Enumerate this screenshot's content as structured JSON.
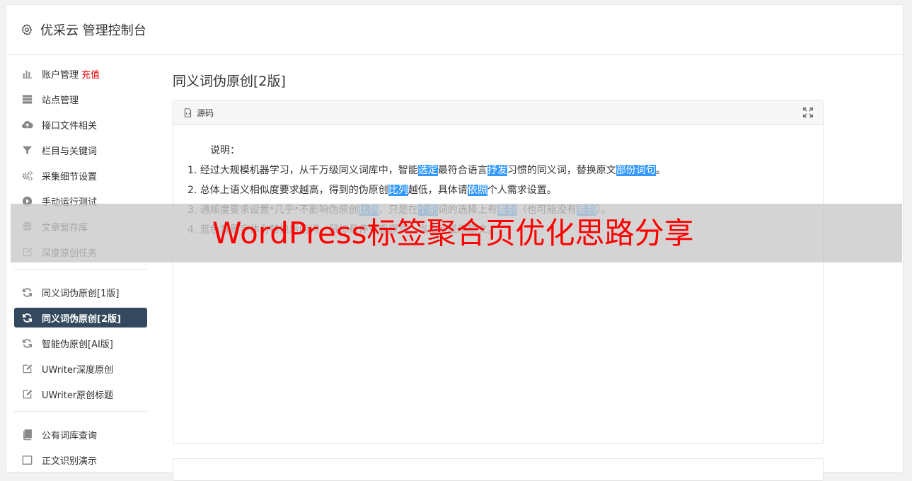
{
  "header": {
    "title": "优采云 管理控制台",
    "icon": "gear-icon"
  },
  "sidebar": {
    "groups": [
      [
        {
          "label": "账户管理",
          "extra": "充值",
          "icon": "bar-chart-icon"
        },
        {
          "label": "站点管理",
          "icon": "server-icon"
        },
        {
          "label": "接口文件相关",
          "icon": "cloud-upload-icon"
        },
        {
          "label": "栏目与关键词",
          "icon": "filter-icon"
        },
        {
          "label": "采集细节设置",
          "icon": "gears-icon"
        },
        {
          "label": "手动运行测试",
          "icon": "play-circle-icon"
        },
        {
          "label": "文章暂存库",
          "icon": "database-icon"
        },
        {
          "label": "深度原创任务",
          "icon": "edit-icon"
        }
      ],
      [
        {
          "label": "同义词伪原创[1版]",
          "icon": "refresh-icon"
        },
        {
          "label": "同义词伪原创[2版]",
          "icon": "refresh-icon",
          "active": true
        },
        {
          "label": "智能伪原创[AI版]",
          "icon": "refresh-icon"
        },
        {
          "label": "UWriter深度原创",
          "icon": "edit-icon"
        },
        {
          "label": "UWriter原创标题",
          "icon": "edit-icon"
        }
      ],
      [
        {
          "label": "公有词库查询",
          "icon": "book-icon"
        },
        {
          "label": "正文识别演示",
          "icon": "square-icon"
        }
      ]
    ]
  },
  "main": {
    "title": "同义词伪原创[2版]",
    "editor": {
      "source_label": "源码",
      "intro": "说明：",
      "lines": [
        [
          {
            "t": "1. 经过大规模机器学习，从千万级同义词库中，智能"
          },
          {
            "t": "选定",
            "hl": true
          },
          {
            "t": "最符合语言"
          },
          {
            "t": "抒发",
            "hl": true
          },
          {
            "t": "习惯的同义词，替换原文"
          },
          {
            "t": "部份",
            "hl": true
          },
          {
            "t": "词句",
            "hl": true
          },
          {
            "t": "。"
          }
        ],
        [
          {
            "t": "2. 总体上语义相似度要求越高，得到的伪原创"
          },
          {
            "t": "比列",
            "hl": true
          },
          {
            "t": "越低，具体请"
          },
          {
            "t": "依照",
            "hl": true
          },
          {
            "t": "个人需求设置。"
          }
        ],
        [
          {
            "t": "3. 通顺度要求设置*几乎*不影响伪原创"
          },
          {
            "t": "比列",
            "hl": true
          },
          {
            "t": "，只是在"
          },
          {
            "t": "个别",
            "hl": true
          },
          {
            "t": "词的选择上有"
          },
          {
            "t": "差别",
            "hl": true
          },
          {
            "t": "（也可能没有"
          },
          {
            "t": "差别",
            "hl": true
          },
          {
            "t": "）。"
          }
        ],
        [
          {
            "t": "4. 蓝色背景字体为替换后的词，鼠标悬停查看原文，点击可显示原文。"
          }
        ]
      ]
    }
  },
  "overlay": {
    "text": "WordPress标签聚合页优化思路分享"
  },
  "colors": {
    "active_bg": "#34495e",
    "highlight": "#3399ff",
    "overlay_text": "#ff0000",
    "recharge": "#e00000"
  }
}
